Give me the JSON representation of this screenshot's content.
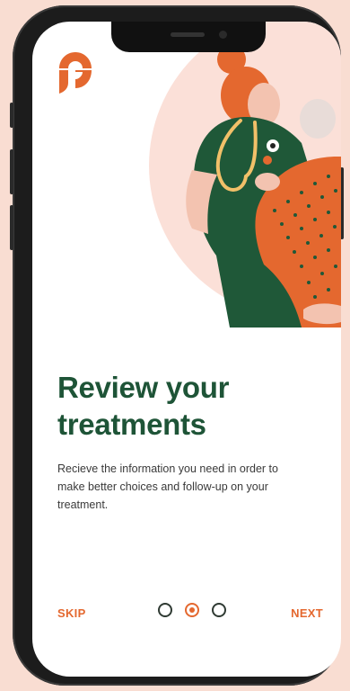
{
  "onboarding": {
    "title_line1": "Review your",
    "title_line2": "treatments",
    "description": "Recieve the information you need in order to make better choices and follow-up on your treatment.",
    "skip_label": "SKIP",
    "next_label": "NEXT",
    "pager": {
      "total": 3,
      "current": 2,
      "dots": [
        {
          "name": "page-dot-1",
          "active": false
        },
        {
          "name": "page-dot-2",
          "active": true
        },
        {
          "name": "page-dot-3",
          "active": false
        }
      ]
    }
  },
  "colors": {
    "accent": "#e4682f",
    "title": "#1e5437",
    "background": "#f9ddd2",
    "illustration_circle": "#fbe0d8",
    "scrubs": "#1f5838"
  },
  "icons": {
    "logo": "brand-logo-icon",
    "stethoscope": "stethoscope-icon"
  }
}
